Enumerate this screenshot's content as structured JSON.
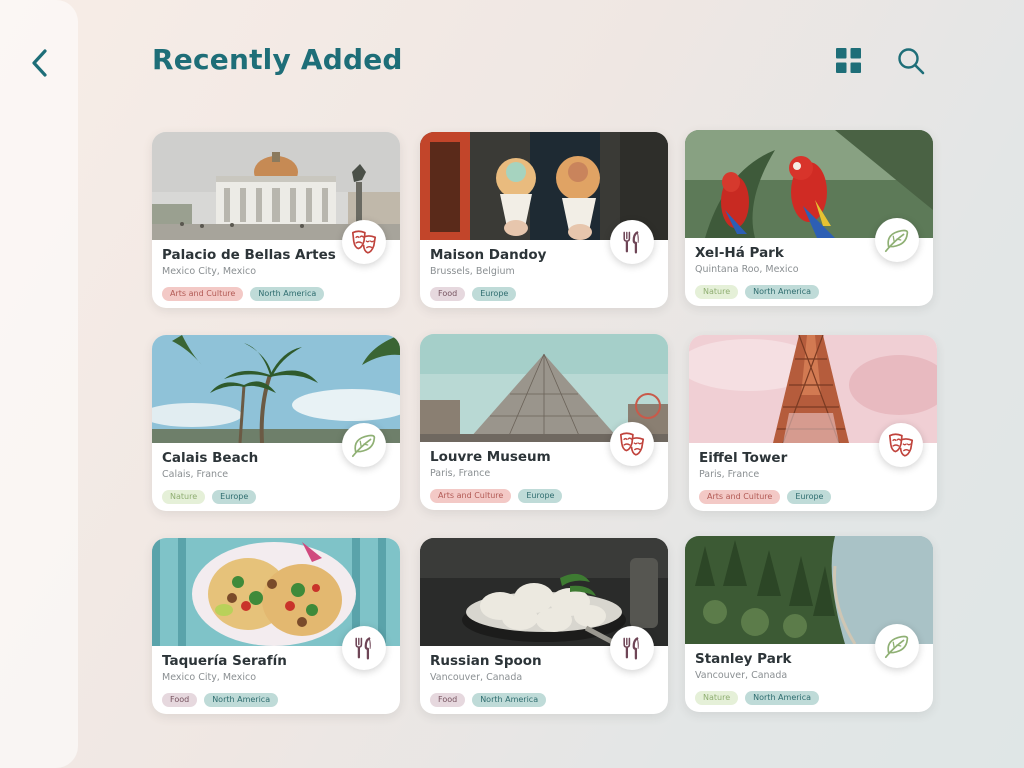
{
  "header": {
    "title": "Recently Added"
  },
  "icons": {
    "back": "chevron-left-icon",
    "view": "grid-view-icon",
    "search": "search-icon"
  },
  "colors": {
    "accent": "#1e6e78",
    "arts": "#c0433c",
    "food": "#6e4556",
    "nature": "#8fb074",
    "region_tag": "#bfdbd8"
  },
  "places": [
    {
      "name": "Palacio de Bellas Artes",
      "location": "Mexico City, Mexico",
      "category": "Arts and Culture",
      "region": "North America",
      "icon": "theater-masks-icon"
    },
    {
      "name": "Maison Dandoy",
      "location": "Brussels, Belgium",
      "category": "Food",
      "region": "Europe",
      "icon": "fork-knife-icon"
    },
    {
      "name": "Xel-Há Park",
      "location": "Quintana Roo, Mexico",
      "category": "Nature",
      "region": "North America",
      "icon": "leaf-icon"
    },
    {
      "name": "Calais Beach",
      "location": "Calais, France",
      "category": "Nature",
      "region": "Europe",
      "icon": "leaf-icon"
    },
    {
      "name": "Louvre Museum",
      "location": "Paris, France",
      "category": "Arts and Culture",
      "region": "Europe",
      "icon": "theater-masks-icon"
    },
    {
      "name": "Eiffel Tower",
      "location": "Paris, France",
      "category": "Arts and Culture",
      "region": "Europe",
      "icon": "theater-masks-icon"
    },
    {
      "name": "Taquería Serafín",
      "location": "Mexico City, Mexico",
      "category": "Food",
      "region": "North America",
      "icon": "fork-knife-icon"
    },
    {
      "name": "Russian Spoon",
      "location": "Vancouver, Canada",
      "category": "Food",
      "region": "North America",
      "icon": "fork-knife-icon"
    },
    {
      "name": "Stanley Park",
      "location": "Vancouver, Canada",
      "category": "Nature",
      "region": "North America",
      "icon": "leaf-icon"
    }
  ]
}
